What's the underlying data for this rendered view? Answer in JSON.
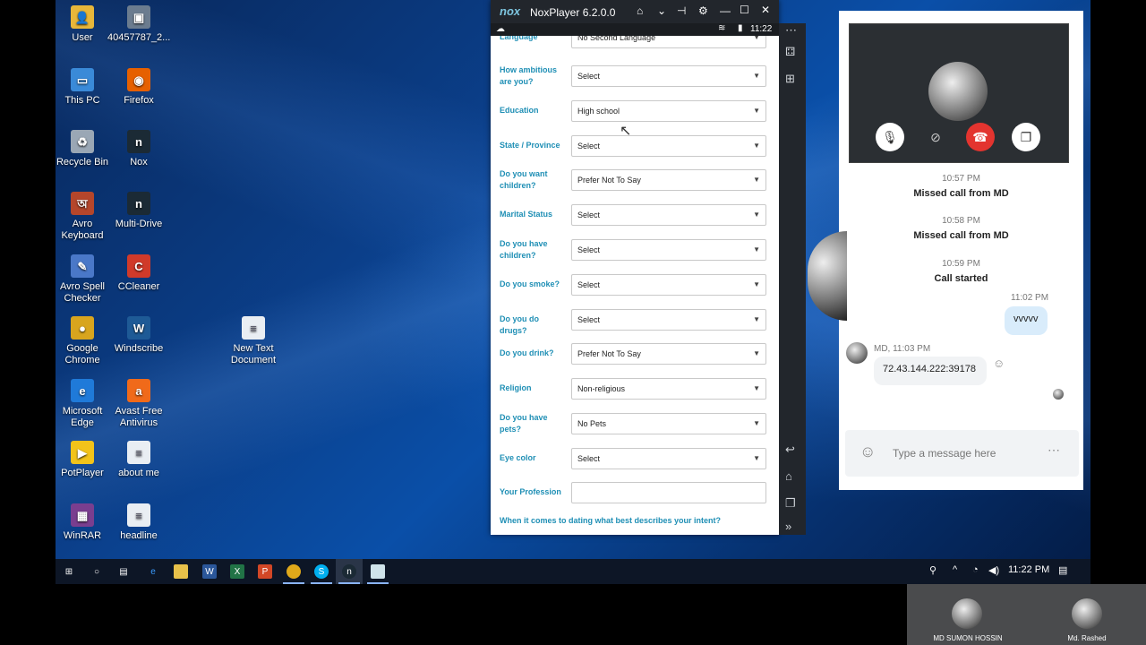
{
  "desktop_icons": [
    {
      "label": "User",
      "color": "#e8b73a",
      "glyph": "👤"
    },
    {
      "label": "40457787_2...",
      "color": "#6b7c8f",
      "glyph": "▣"
    },
    {
      "label": "This PC",
      "color": "#3a8ad8",
      "glyph": "▭"
    },
    {
      "label": "Firefox",
      "color": "#e66000",
      "glyph": "◉"
    },
    {
      "label": "Recycle Bin",
      "color": "#9aa7b5",
      "glyph": "♻"
    },
    {
      "label": "Nox",
      "color": "#1b2a35",
      "glyph": "n"
    },
    {
      "label": "Avro Keyboard",
      "color": "#b5462b",
      "glyph": "অ"
    },
    {
      "label": "Multi-Drive",
      "color": "#1b2a35",
      "glyph": "n"
    },
    {
      "label": "Avro Spell Checker",
      "color": "#4a78c8",
      "glyph": "✎"
    },
    {
      "label": "CCleaner",
      "color": "#d03a2a",
      "glyph": "C"
    },
    {
      "label": "Google Chrome",
      "color": "#d8a51e",
      "glyph": "●"
    },
    {
      "label": "Windscribe",
      "color": "#1e5a96",
      "glyph": "W"
    },
    {
      "label": "New Text Document",
      "color": "#e9eef3",
      "glyph": "≡"
    },
    {
      "label": "Microsoft Edge",
      "color": "#1f7ad9",
      "glyph": "e"
    },
    {
      "label": "Avast Free Antivirus",
      "color": "#f06a1a",
      "glyph": "a"
    },
    {
      "label": "PotPlayer",
      "color": "#f2c31a",
      "glyph": "▶"
    },
    {
      "label": "about me",
      "color": "#e9eef3",
      "glyph": "≡"
    },
    {
      "label": "WinRAR",
      "color": "#7a3e8f",
      "glyph": "▦"
    },
    {
      "label": "headline",
      "color": "#e9eef3",
      "glyph": "≡"
    }
  ],
  "nox": {
    "logo": "nox",
    "title": "NoxPlayer 6.2.0.0",
    "time": "11:22",
    "form": [
      {
        "label": "Language",
        "value": "No Second Language"
      },
      {
        "label": "How ambitious are you?",
        "value": "Select"
      },
      {
        "label": "Education",
        "value": "High school"
      },
      {
        "label": "State / Province",
        "value": "Select"
      },
      {
        "label": "Do you want children?",
        "value": "Prefer Not To Say"
      },
      {
        "label": "Marital Status",
        "value": "Select"
      },
      {
        "label": "Do you have children?",
        "value": "Select"
      },
      {
        "label": "Do you smoke?",
        "value": "Select"
      },
      {
        "label": "Do you do drugs?",
        "value": "Select"
      },
      {
        "label": "Do you drink?",
        "value": "Prefer Not To Say"
      },
      {
        "label": "Religion",
        "value": "Non-religious"
      },
      {
        "label": "Do you have pets?",
        "value": "No Pets"
      },
      {
        "label": "Eye color",
        "value": "Select"
      },
      {
        "label": "Your Profession",
        "value": ""
      }
    ],
    "intent_label": "When it comes to dating what best describes your intent?"
  },
  "skype": {
    "messages": [
      {
        "time": "10:57 PM",
        "text": "Missed call from MD"
      },
      {
        "time": "10:58 PM",
        "text": "Missed call from MD"
      },
      {
        "time": "10:59 PM",
        "text": "Call started"
      }
    ],
    "my_time": "11:02 PM",
    "my_message": "vvvvv",
    "their_header": "MD, 11:03 PM",
    "their_message": "72.43.144.222:39178",
    "composer_placeholder": "Type a message here"
  },
  "taskbar": {
    "time": "11:22 PM"
  },
  "participants": [
    {
      "name": "MD SUMON HOSSIN"
    },
    {
      "name": "Md. Rashed"
    }
  ]
}
